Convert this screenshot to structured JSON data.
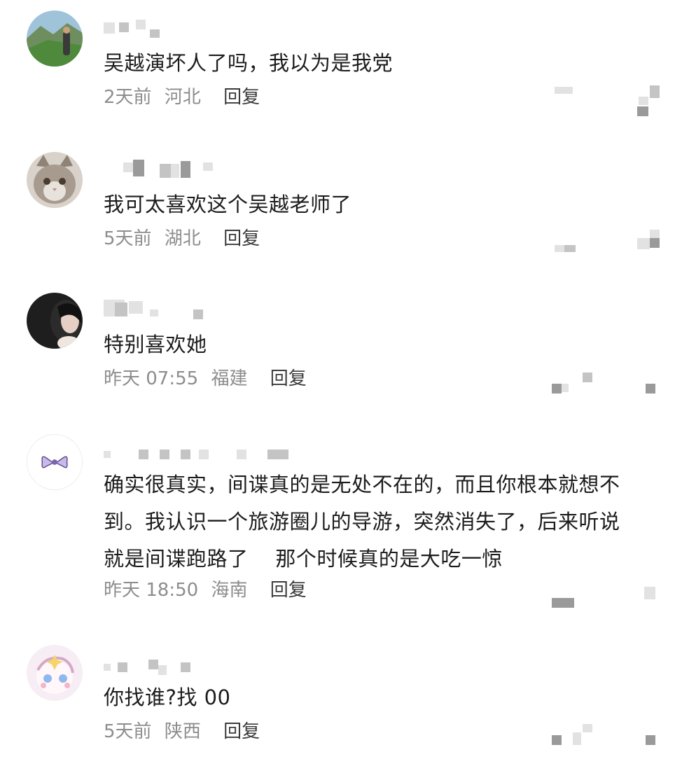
{
  "comments": [
    {
      "text": "吴越演坏人了吗，我以为是我党",
      "time": "2天前",
      "location": "河北",
      "reply": "回复"
    },
    {
      "text": "我可太喜欢这个吴越老师了",
      "time": "5天前",
      "location": "湖北",
      "reply": "回复"
    },
    {
      "text": "特别喜欢她",
      "time": "昨天 07:55",
      "location": "福建",
      "reply": "回复"
    },
    {
      "text_lines": [
        "确实很真实，间谍真的是无处不在的，而且你根本就想不",
        "到。我认识一个旅游圈儿的导游，突然消失了，后来听说",
        "就是间谍跑路了    那个时候真的是大吃一惊"
      ],
      "time": "昨天 18:50",
      "location": "海南",
      "reply": "回复"
    },
    {
      "text": "你找谁?找 00",
      "time": "5天前",
      "location": "陕西",
      "reply": "回复"
    }
  ]
}
